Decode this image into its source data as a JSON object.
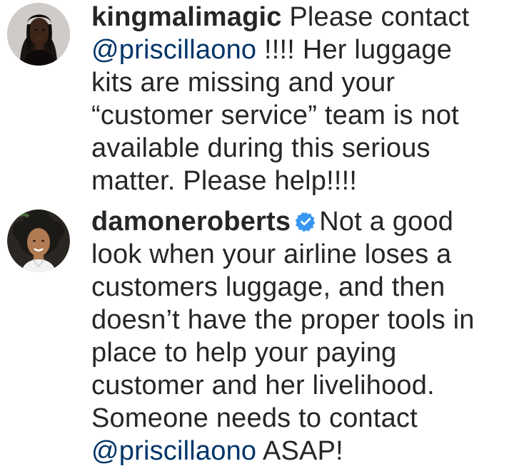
{
  "comments": [
    {
      "username": "kingmalimagic",
      "verified": false,
      "avatar_icon": "profile-photo-avatar",
      "lines": [
        {
          "text_after_username": " Please contact"
        },
        {
          "mention": "@priscillaono",
          "text": " !!!! Her luggage"
        },
        {
          "text": "kits are missing and your"
        },
        {
          "text": "“customer service” team is not"
        },
        {
          "text": "available during this serious"
        },
        {
          "text": "matter. Please help!!!!"
        }
      ]
    },
    {
      "username": "damoneroberts",
      "verified": true,
      "verified_icon": "verified-badge-icon",
      "avatar_icon": "profile-photo-avatar",
      "lines": [
        {
          "text_after_username": "Not a good"
        },
        {
          "text": "look when your airline loses a"
        },
        {
          "text": "customers luggage, and then"
        },
        {
          "text": "doesn’t have the proper tools in"
        },
        {
          "text": "place to help your paying"
        },
        {
          "text": "customer and her livelihood."
        },
        {
          "text": "Someone needs to contact"
        },
        {
          "mention": "@priscillaono",
          "text": " ASAP!"
        }
      ]
    }
  ],
  "colors": {
    "text": "#262626",
    "mention": "#003569",
    "verified": "#3897f0",
    "background": "#ffffff"
  }
}
